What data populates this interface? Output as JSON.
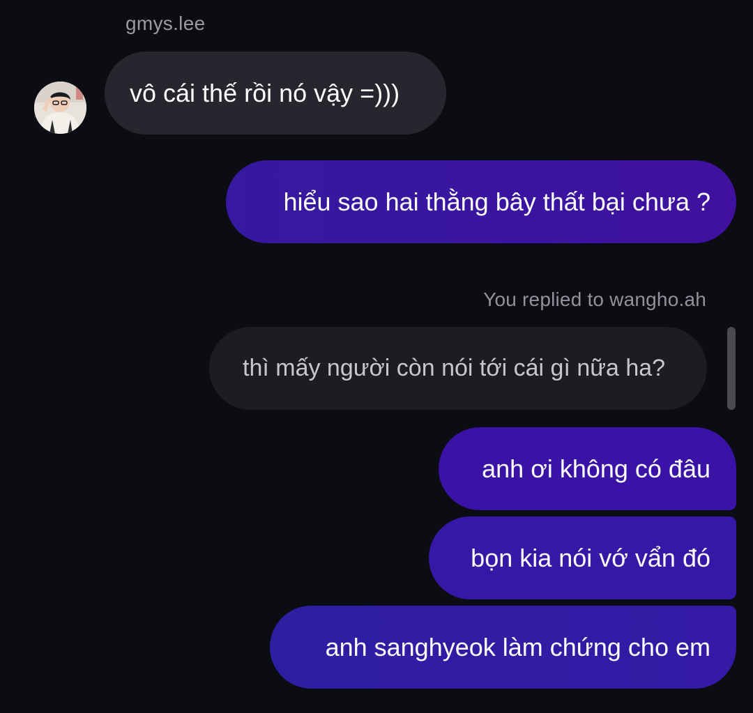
{
  "thread": {
    "sender_username": "gmys.lee",
    "reply_label": "You replied to wangho.ah",
    "quoted_text": "thì mấy người còn nói tới cái gì nữa ha?"
  },
  "messages": {
    "incoming": [
      {
        "text": "vô cái thế rồi nó vậy =)))"
      }
    ],
    "outgoing": [
      {
        "text": "hiểu sao hai thằng bây thất bại chưa ?"
      },
      {
        "text": "anh ơi không có đâu"
      },
      {
        "text": "bọn kia nói vớ vẩn đó"
      },
      {
        "text": "anh sanghyeok làm chứng cho em"
      }
    ]
  },
  "colors": {
    "background": "#0c0c13",
    "incoming_bubble": "#26272e",
    "outgoing_bubble": "#3a13a6",
    "quoted_bubble": "#1c1c21",
    "secondary_text": "#9a9aa3"
  },
  "icons": {
    "avatar": "profile-photo"
  }
}
